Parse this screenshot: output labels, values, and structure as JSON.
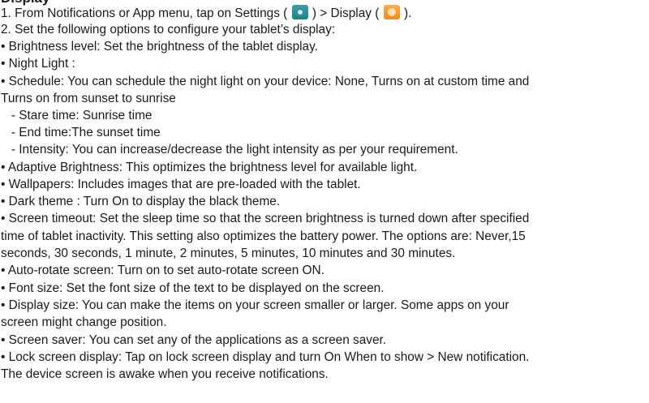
{
  "heading": "Display",
  "step1": {
    "pre": "1. From Notifications or App menu, tap on Settings ( ",
    "mid": " ) > Display ( ",
    "post": " )."
  },
  "icons": {
    "settings": "settings-icon",
    "display": "display-icon"
  },
  "lines": [
    "2. Set the following options to configure your tablet’s display:",
    "• Brightness level: Set the brightness of the tablet display.",
    "• Night Light :",
    "• Schedule: You can schedule the night light on your device: None, Turns on at custom time and",
    "Turns on from sunset to sunrise",
    "   - Stare time: Sunrise time",
    "   - End time:The sunset time",
    "   - Intensity: You can increase/decrease the light intensity as per your requirement.",
    "• Adaptive Brightness: This optimizes the brightness level for available light.",
    "• Wallpapers: Includes images that are pre-loaded with the tablet.",
    "• Dark theme : Turn On to display the black theme.",
    "• Screen timeout: Set the sleep time so that the screen brightness is turned down after specified",
    "time of tablet inactivity. This setting also optimizes the battery power. The options are: Never,15",
    "seconds, 30 seconds, 1 minute, 2 minutes, 5 minutes, 10 minutes and 30 minutes.",
    "• Auto-rotate screen: Turn on to set auto-rotate screen ON.",
    "• Font size: Set the font size of the text to be displayed on the screen.",
    "• Display size: You can make the items on your screen smaller or larger. Some apps on your",
    "screen might change position.",
    "• Screen saver: You can set any of the applications as a screen saver.",
    "• Lock screen display: Tap on lock screen display and turn On When to show > New notification.",
    "The device screen is awake when you receive notifications."
  ]
}
